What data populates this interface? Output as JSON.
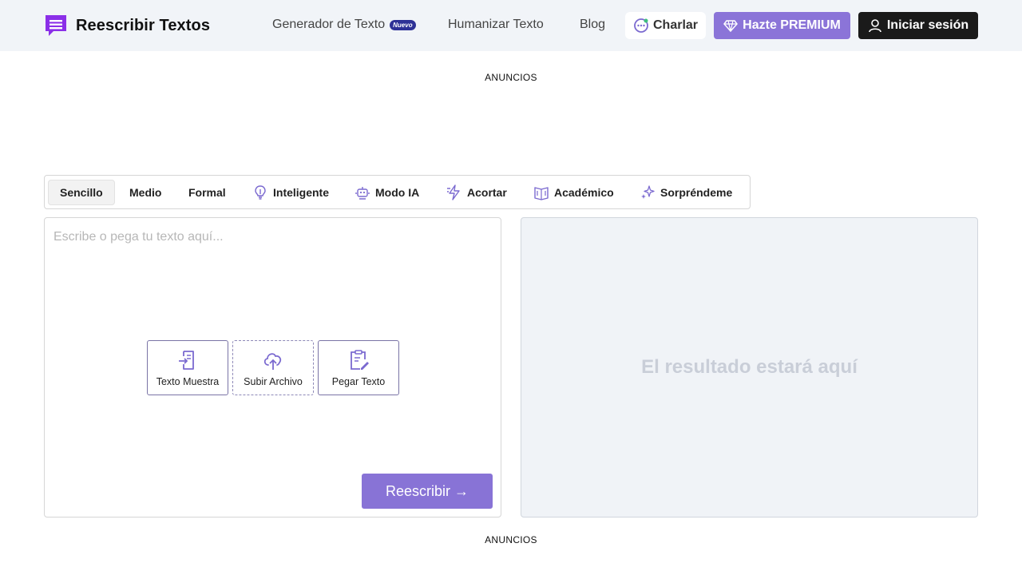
{
  "header": {
    "logo_text": "Reescribir Textos",
    "nav": {
      "generator": "Generador de Texto",
      "generator_badge": "Nuevo",
      "humanize": "Humanizar Texto",
      "blog": "Blog"
    },
    "chat_label": "Charlar",
    "premium_label": "Hazte PREMIUM",
    "login_label": "Iniciar sesión"
  },
  "ads": {
    "top_label": "ANUNCIOS",
    "bottom_label": "ANUNCIOS"
  },
  "modes": {
    "tabs": [
      {
        "label": "Sencillo",
        "icon": "none",
        "active": true
      },
      {
        "label": "Medio",
        "icon": "none",
        "active": false
      },
      {
        "label": "Formal",
        "icon": "none",
        "active": false
      },
      {
        "label": "Inteligente",
        "icon": "lightbulb-icon",
        "active": false
      },
      {
        "label": "Modo IA",
        "icon": "robot-icon",
        "active": false
      },
      {
        "label": "Acortar",
        "icon": "lightning-icon",
        "active": false
      },
      {
        "label": "Académico",
        "icon": "book-icon",
        "active": false
      },
      {
        "label": "Sorpréndeme",
        "icon": "sparkles-icon",
        "active": false
      }
    ]
  },
  "editor": {
    "placeholder": "Escribe o pega tu texto aquí...",
    "sample_label": "Texto Muestra",
    "upload_label": "Subir Archivo",
    "paste_label": "Pegar Texto",
    "rewrite_label": "Reescribir →"
  },
  "output": {
    "placeholder": "El resultado estará aquí"
  },
  "colors": {
    "accent": "#8b74d8",
    "logo": "#7c3aed",
    "header_bg": "#f1f4f8",
    "output_bg": "#f0f3f7"
  }
}
